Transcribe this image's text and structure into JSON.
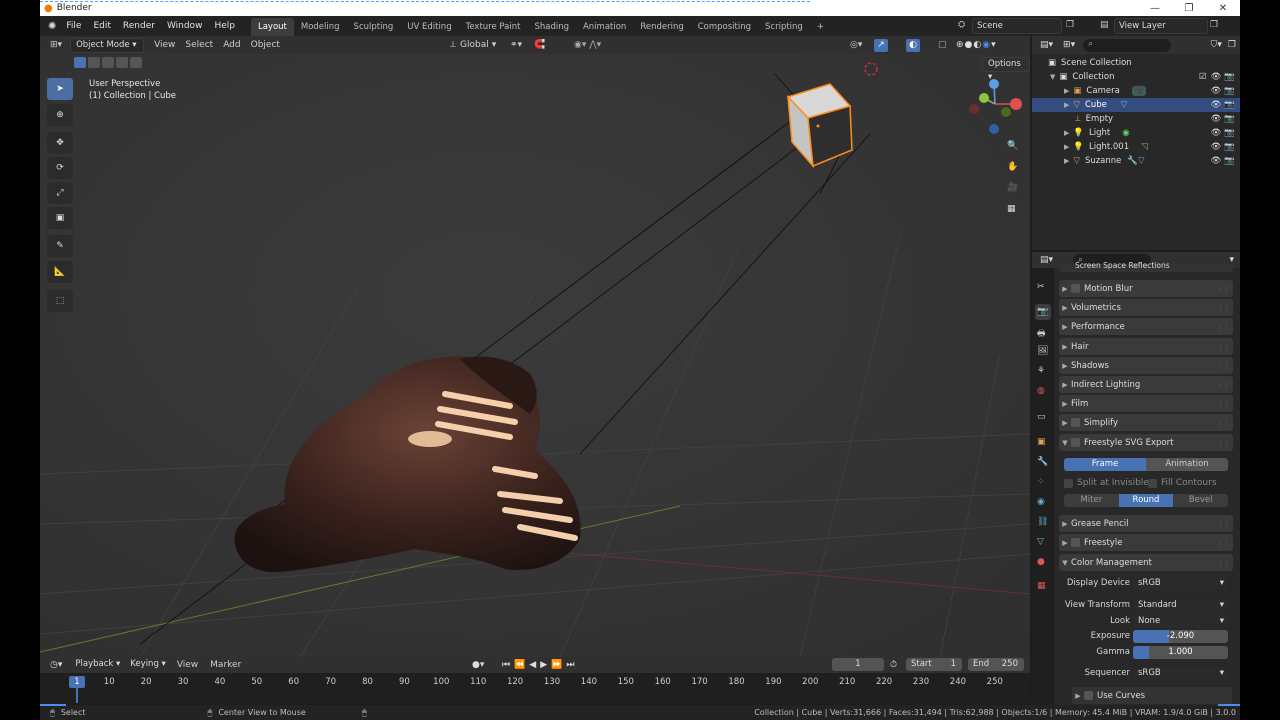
{
  "window": {
    "title": "Blender",
    "buttons": [
      "—",
      "❐",
      "✕"
    ]
  },
  "menu": [
    "File",
    "Edit",
    "Render",
    "Window",
    "Help"
  ],
  "workspaces": [
    "Layout",
    "Modeling",
    "Sculpting",
    "UV Editing",
    "Texture Paint",
    "Shading",
    "Animation",
    "Rendering",
    "Compositing",
    "Scripting",
    "+"
  ],
  "active_workspace": "Layout",
  "scene": {
    "name": "Scene",
    "view_layer": "View Layer"
  },
  "viewport_header": {
    "mode": "Object Mode",
    "menus": [
      "View",
      "Select",
      "Add",
      "Object"
    ],
    "transform": "Global",
    "options": "Options"
  },
  "viewport": {
    "line1": "User Perspective",
    "line2": "(1) Collection | Cube"
  },
  "timeline": {
    "menus": [
      "Playback",
      "Keying",
      "View",
      "Marker"
    ],
    "current_frame": "1",
    "start_label": "Start",
    "start": "1",
    "end_label": "End",
    "end": "250",
    "ruler": [
      "1",
      "10",
      "20",
      "30",
      "40",
      "50",
      "60",
      "70",
      "80",
      "90",
      "100",
      "110",
      "120",
      "130",
      "140",
      "150",
      "160",
      "170",
      "180",
      "190",
      "200",
      "210",
      "220",
      "230",
      "240",
      "250"
    ]
  },
  "status": {
    "select": "Select",
    "center": "Center View to Mouse",
    "info": "Collection | Cube | Verts:31,666 | Faces:31,494 | Tris:62,988 | Objects:1/6 | Memory: 45.4 MiB | VRAM: 1.9/4.0 GiB | 3.0.0"
  },
  "outliner": {
    "root": "Scene Collection",
    "collection": "Collection",
    "items": [
      "Camera",
      "Cube",
      "Empty",
      "Light",
      "Light.001",
      "Suzanne"
    ],
    "selected": "Cube"
  },
  "properties": {
    "cut_top": "Screen Space Reflections",
    "panels": [
      "Motion Blur",
      "Volumetrics",
      "Performance",
      "Hair",
      "Shadows",
      "Indirect Lighting",
      "Film",
      "Simplify",
      "Freestyle SVG Export"
    ],
    "svg_modes": [
      "Frame",
      "Animation"
    ],
    "split_invisible": "Split at Invisible",
    "fill_contours": "Fill Contours",
    "joins": [
      "Miter",
      "Round",
      "Bevel"
    ],
    "grease_pencil": "Grease Pencil",
    "freestyle": "Freestyle",
    "color_management": "Color Management",
    "display_device_label": "Display Device",
    "display_device": "sRGB",
    "view_transform_label": "View Transform",
    "view_transform": "Standard",
    "look_label": "Look",
    "look": "None",
    "exposure_label": "Exposure",
    "exposure": "-2.090",
    "gamma_label": "Gamma",
    "gamma": "1.000",
    "sequencer_label": "Sequencer",
    "sequencer": "sRGB",
    "use_curves": "Use Curves"
  },
  "colors": {
    "accent": "#4772b3",
    "selection": "#334d80",
    "object_outline": "#ff8c1a"
  }
}
